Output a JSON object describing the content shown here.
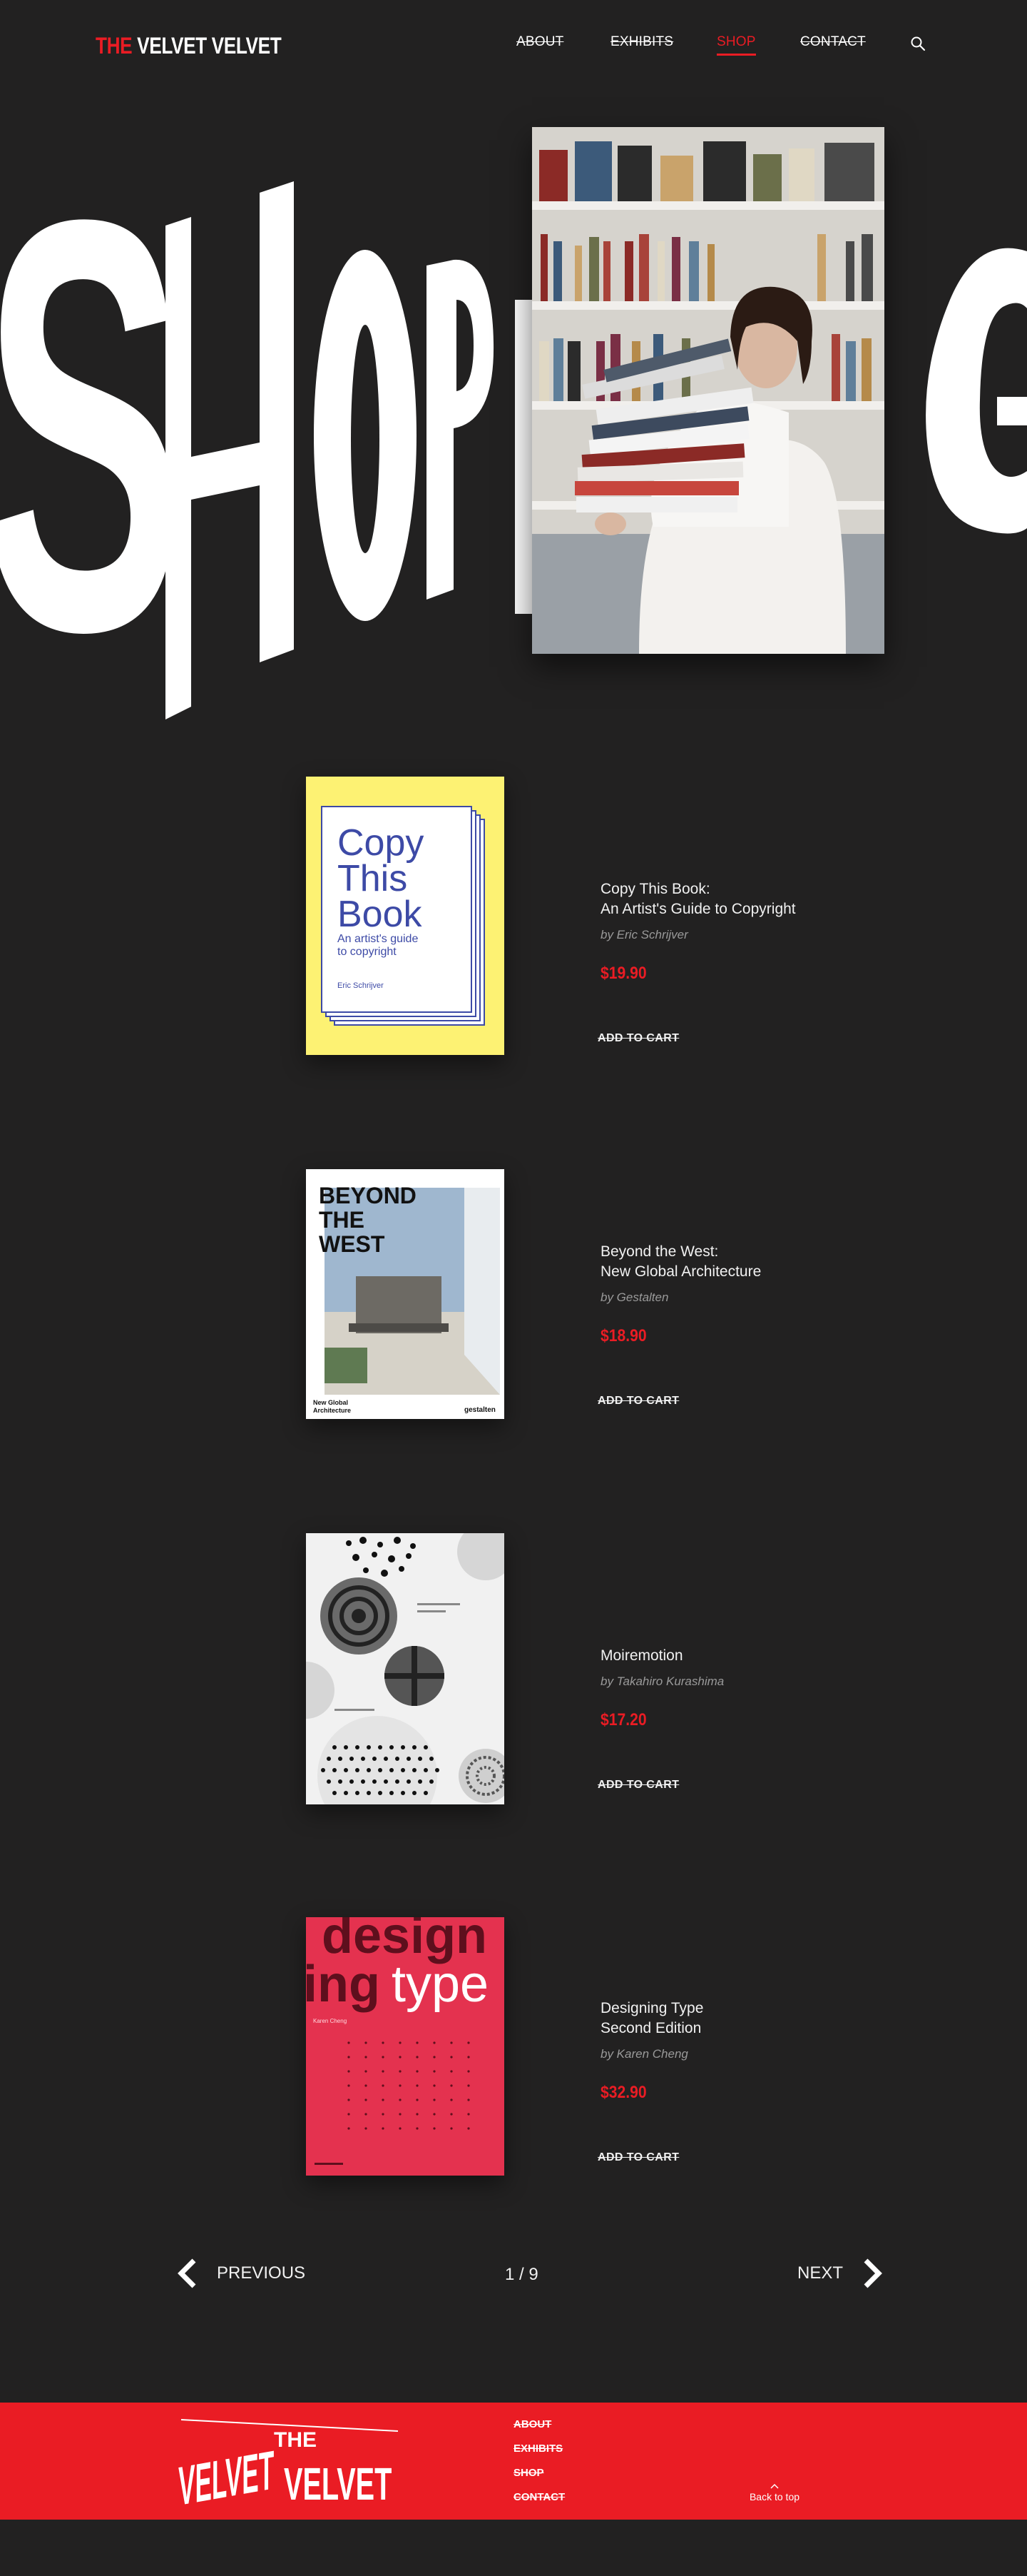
{
  "header": {
    "logo_the": "THE",
    "logo_rest": "VELVET VELVET",
    "nav": [
      {
        "label": "ABOUT",
        "active": false
      },
      {
        "label": "EXHIBITS",
        "active": false
      },
      {
        "label": "SHOP",
        "active": true
      },
      {
        "label": "CONTACT",
        "active": false
      }
    ],
    "search_icon": "search-icon"
  },
  "hero": {
    "heading_left": "SHOP",
    "heading_right": "G"
  },
  "products": [
    {
      "title_line1": "Copy This Book:",
      "title_line2": "An Artist's Guide to Copyright",
      "author": "by Eric Schrijver",
      "price": "$19.90",
      "cart": "ADD TO CART",
      "cover": {
        "title": [
          "Copy",
          "This",
          "Book"
        ],
        "subtitle": [
          "An artist's guide",
          "to copyright"
        ],
        "author": "Eric Schrijver"
      }
    },
    {
      "title_line1": "Beyond the West:",
      "title_line2": "New Global Architecture",
      "author": "by Gestalten",
      "price": "$18.90",
      "cart": "ADD TO CART",
      "cover": {
        "title": [
          "BEYOND",
          "THE",
          "WEST"
        ],
        "subtitle": [
          "New Global",
          "Architecture"
        ],
        "publisher": "gestalten"
      }
    },
    {
      "title_line1": "Moiremotion",
      "title_line2": "",
      "author": "by Takahiro Kurashima",
      "price": "$17.20",
      "cart": "ADD TO CART",
      "cover": {}
    },
    {
      "title_line1": "Designing Type",
      "title_line2": "Second Edition",
      "author": "by Karen Cheng",
      "price": "$32.90",
      "cart": "ADD TO CART",
      "cover": {
        "word1": "design",
        "word2": "ing",
        "word3": "type",
        "author": "Karen Cheng"
      }
    }
  ],
  "pagination": {
    "prev": "PREVIOUS",
    "next": "NEXT",
    "count": "1 / 9"
  },
  "footer": {
    "logo_the": "THE",
    "logo_v1": "VELVET",
    "logo_v2": "VELVET",
    "links": [
      "ABOUT",
      "EXHIBITS",
      "SHOP",
      "CONTACT"
    ],
    "back_to_top": "Back to top"
  },
  "colors": {
    "background": "#222121",
    "accent": "#ea1c24",
    "text": "#ffffff",
    "muted": "#9a9a9a"
  }
}
